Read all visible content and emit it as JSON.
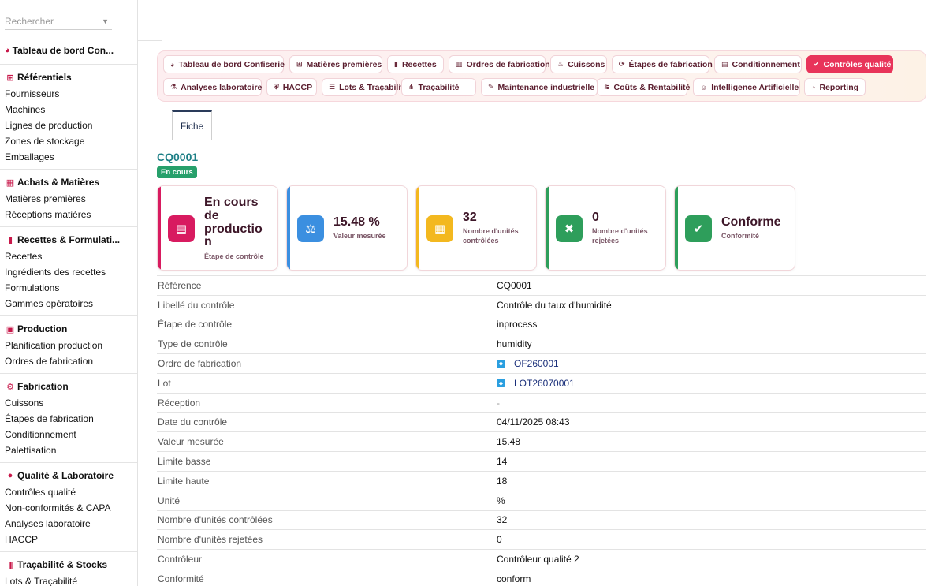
{
  "sidebar": {
    "search_placeholder": "Rechercher",
    "top_item": "Tableau de bord Con...",
    "sections": [
      {
        "title": "Référentiels",
        "icon": "sitemap-icon",
        "items": [
          "Fournisseurs",
          "Machines",
          "Lignes de production",
          "Zones de stockage",
          "Emballages"
        ]
      },
      {
        "title": "Achats & Matières",
        "icon": "boxes-icon",
        "items": [
          "Matières premières",
          "Réceptions matières"
        ]
      },
      {
        "title": "Recettes & Formulati...",
        "icon": "book-icon",
        "items": [
          "Recettes",
          "Ingrédients des recettes",
          "Formulations",
          "Gammes opératoires"
        ]
      },
      {
        "title": "Production",
        "icon": "calendar-icon",
        "items": [
          "Planification production",
          "Ordres de fabrication"
        ]
      },
      {
        "title": "Fabrication",
        "icon": "gears-icon",
        "items": [
          "Cuissons",
          "Étapes de fabrication",
          "Conditionnement",
          "Palettisation"
        ]
      },
      {
        "title": "Qualité & Laboratoire",
        "icon": "check-circle-icon",
        "items": [
          "Contrôles qualité",
          "Non-conformités & CAPA",
          "Analyses laboratoire",
          "HACCP"
        ]
      },
      {
        "title": "Traçabilité & Stocks",
        "icon": "barcode-icon",
        "items": [
          "Lots & Traçabilité"
        ]
      }
    ]
  },
  "modules": {
    "row1": [
      "Tableau de bord Confiserie",
      "Matières premières",
      "Recettes",
      "Ordres de fabrication",
      "Cuissons",
      "Étapes de fabrication",
      "Conditionnement",
      "Contrôles qualité"
    ],
    "row2": [
      "Analyses laboratoire",
      "HACCP",
      "Lots & Traçabilité",
      "Traçabilité",
      "Maintenance industrielle",
      "Coûts & Rentabilité",
      "Intelligence Artificielle",
      "Reporting"
    ],
    "active": "Contrôles qualité"
  },
  "tabs": {
    "fiche": "Fiche"
  },
  "record": {
    "title": "CQ0001",
    "status_badge": "En cours"
  },
  "kpis": [
    {
      "value": "En cours de productio n",
      "label": "Étape de contrôle",
      "color": "#d81b60",
      "icon": "clipboard-check-icon"
    },
    {
      "value": "15.48 %",
      "label": "Valeur mesurée",
      "color": "#3b8fe0",
      "icon": "balance-scale-icon"
    },
    {
      "value": "32",
      "label": "Nombre d'unités contrôlées",
      "color": "#f3b81f",
      "icon": "boxes-icon"
    },
    {
      "value": "0",
      "label": "Nombre d'unités rejetées",
      "color": "#2e9e5b",
      "icon": "times-circle-icon"
    },
    {
      "value": "Conforme",
      "label": "Conformité",
      "color": "#2e9e5b",
      "icon": "check-circle-icon"
    }
  ],
  "fields": [
    {
      "label": "Référence",
      "value": "CQ0001"
    },
    {
      "label": "Libellé du contrôle",
      "value": "Contrôle du taux d'humidité"
    },
    {
      "label": "Étape de contrôle",
      "value": "inprocess"
    },
    {
      "label": "Type de contrôle",
      "value": "humidity"
    },
    {
      "label": "Ordre de fabrication",
      "value": "OF260001",
      "link": true
    },
    {
      "label": "Lot",
      "value": "LOT26070001",
      "link": true
    },
    {
      "label": "Réception",
      "value": "-",
      "muted": true
    },
    {
      "label": "Date du contrôle",
      "value": "04/11/2025 08:43"
    },
    {
      "label": "Valeur mesurée",
      "value": "15.48"
    },
    {
      "label": "Limite basse",
      "value": "14"
    },
    {
      "label": "Limite haute",
      "value": "18"
    },
    {
      "label": "Unité",
      "value": "%"
    },
    {
      "label": "Nombre d'unités contrôlées",
      "value": "32"
    },
    {
      "label": "Nombre d'unités rejetées",
      "value": "0"
    },
    {
      "label": "Contrôleur",
      "value": "Contrôleur qualité 2"
    },
    {
      "label": "Conformité",
      "value": "conform"
    }
  ]
}
